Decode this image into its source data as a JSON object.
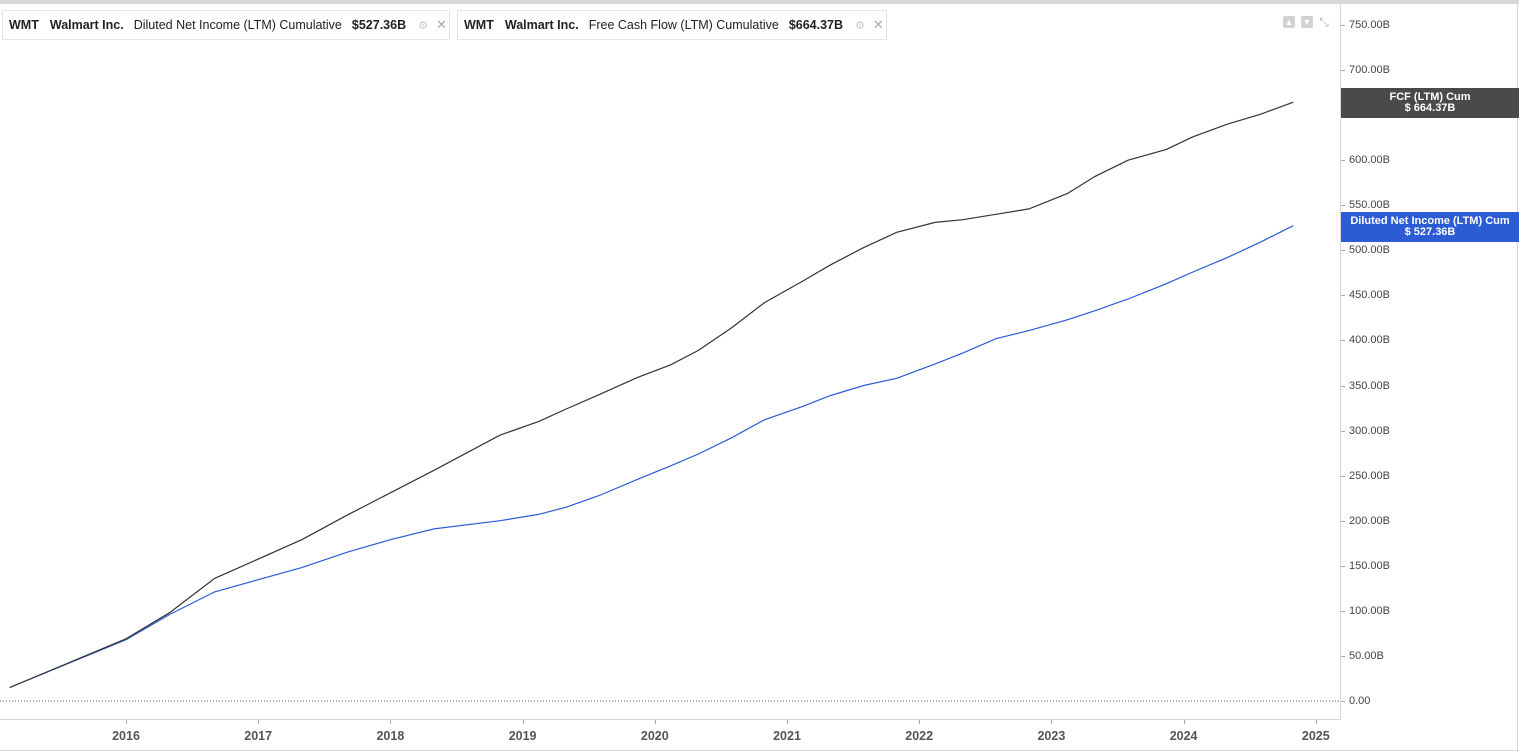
{
  "legend": [
    {
      "ticker": "WMT",
      "company": "Walmart Inc.",
      "metric": "Diluted Net Income (LTM) Cumulative",
      "value": "$527.36B",
      "color": "#2c5bd6",
      "icon": "settings-icon",
      "close_icon": "close-icon"
    },
    {
      "ticker": "WMT",
      "company": "Walmart Inc.",
      "metric": "Free Cash Flow (LTM) Cumulative",
      "value": "$664.37B",
      "color": "#333333",
      "icon": "settings-icon",
      "close_icon": "close-icon"
    }
  ],
  "tags": {
    "fcf": {
      "line1": "FCF (LTM) Cum",
      "line2": "$ 664.37B",
      "color": "#4a4a4a"
    },
    "ni": {
      "line1": "Diluted Net Income (LTM) Cum",
      "line2": "$ 527.36B",
      "color": "#2c5bd6"
    }
  },
  "controls": [
    "arrow-up-icon",
    "arrow-down-icon",
    "collapse-icon"
  ],
  "chart_data": {
    "type": "line",
    "x_tick_labels": [
      "2016",
      "2017",
      "2018",
      "2019",
      "2020",
      "2021",
      "2022",
      "2023",
      "2024",
      "2025"
    ],
    "y_tick_labels": [
      "0.00",
      "50.00B",
      "100.00B",
      "150.00B",
      "200.00B",
      "250.00B",
      "300.00B",
      "350.00B",
      "400.00B",
      "450.00B",
      "500.00B",
      "550.00B",
      "600.00B",
      "650.00B",
      "700.00B",
      "750.00B"
    ],
    "ylim": [
      0,
      750
    ],
    "xlim": [
      2015.1,
      2025.15
    ],
    "zero_line": "dotted",
    "series": [
      {
        "name": "Diluted Net Income (LTM) Cumulative",
        "color": "#2c5bd6",
        "x": [
          2015.12,
          2016.0,
          2016.33,
          2016.67,
          2017.33,
          2017.67,
          2018.0,
          2018.33,
          2018.83,
          2019.12,
          2019.33,
          2019.58,
          2019.87,
          2020.12,
          2020.33,
          2020.58,
          2020.83,
          2021.12,
          2021.33,
          2021.58,
          2021.83,
          2022.12,
          2022.33,
          2022.58,
          2022.83,
          2023.12,
          2023.33,
          2023.58,
          2023.87,
          2024.07,
          2024.33,
          2024.58,
          2024.83
        ],
        "y": [
          15,
          68,
          96,
          121,
          148,
          165,
          179,
          191,
          200,
          207,
          215,
          228,
          246,
          261,
          274,
          292,
          312,
          327,
          339,
          350,
          358,
          374,
          386,
          402,
          411,
          423,
          433,
          446,
          463,
          476,
          492,
          509,
          527.36
        ]
      },
      {
        "name": "Free Cash Flow (LTM) Cumulative",
        "color": "#333333",
        "x": [
          2015.12,
          2016.0,
          2016.33,
          2016.67,
          2017.33,
          2017.67,
          2018.0,
          2018.33,
          2018.83,
          2019.12,
          2019.33,
          2019.58,
          2019.87,
          2020.12,
          2020.33,
          2020.58,
          2020.83,
          2021.12,
          2021.33,
          2021.58,
          2021.83,
          2022.12,
          2022.33,
          2022.58,
          2022.83,
          2023.12,
          2023.33,
          2023.58,
          2023.87,
          2024.07,
          2024.33,
          2024.58,
          2024.83
        ],
        "y": [
          15,
          69,
          98,
          136,
          179,
          206,
          231,
          256,
          295,
          310,
          324,
          340,
          359,
          373,
          389,
          414,
          442,
          466,
          484,
          503,
          520,
          531,
          534,
          540,
          546,
          563,
          582,
          600,
          612,
          626,
          640,
          651,
          664.37
        ]
      }
    ]
  }
}
